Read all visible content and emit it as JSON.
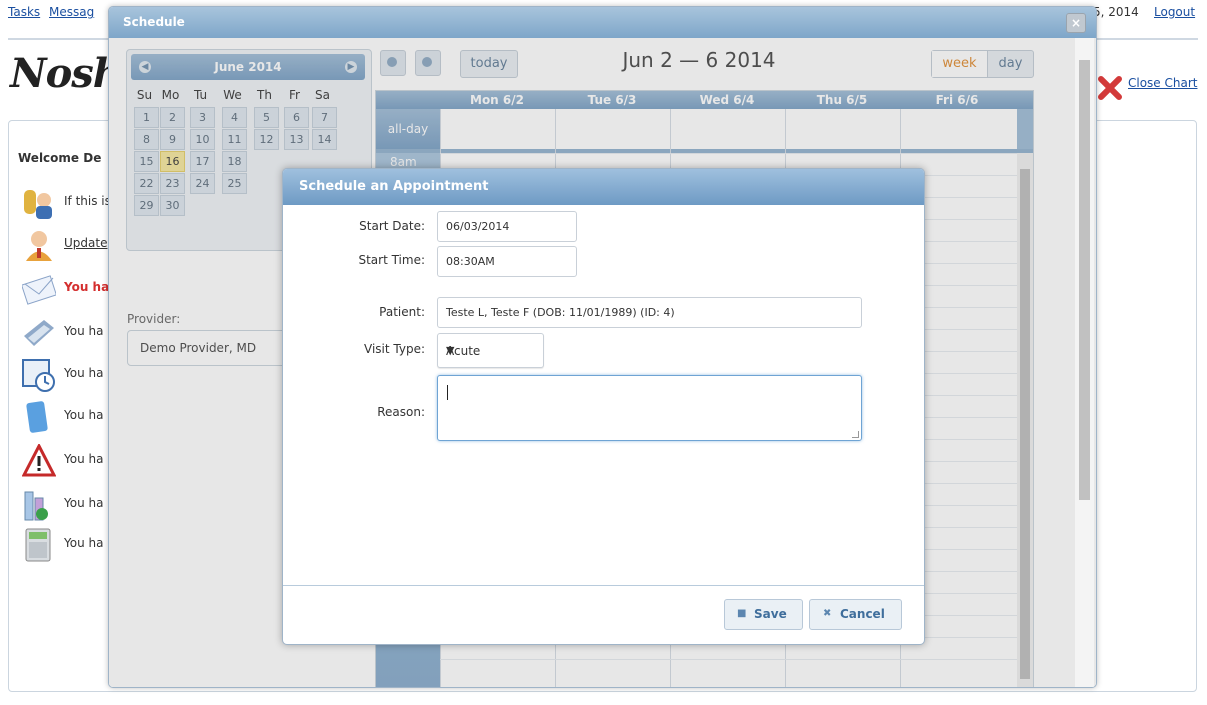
{
  "top_nav": {
    "tasks": "Tasks",
    "messages_partial": "Messag",
    "date_partial": "5, 2014",
    "logout": "Logout"
  },
  "brand": {
    "logo_text": "Nosh"
  },
  "sidebar": {
    "welcome_partial": "Welcome De",
    "alerts": [
      {
        "text": "If this is",
        "icon": "keys-person-icon",
        "highlight": false
      },
      {
        "text": "Update",
        "icon": "person-icon",
        "highlight": false,
        "link": true
      },
      {
        "text": "You ha",
        "icon": "envelope-icon",
        "highlight": true
      },
      {
        "text": "You ha",
        "icon": "scanner-icon",
        "highlight": false
      },
      {
        "text": "You ha",
        "icon": "calendar-clock-icon",
        "highlight": false
      },
      {
        "text": "You ha",
        "icon": "notebook-icon",
        "highlight": false
      },
      {
        "text": "You ha",
        "icon": "warning-icon",
        "highlight": false
      },
      {
        "text": "You ha",
        "icon": "lab-flask-icon",
        "highlight": false
      },
      {
        "text": "You ha",
        "icon": "calculator-icon",
        "highlight": false
      }
    ]
  },
  "close_chart": {
    "label": "Close Chart"
  },
  "schedule": {
    "title": "Schedule",
    "mini_calendar": {
      "month": "June 2014",
      "weekdays": [
        "Su",
        "Mo",
        "Tu",
        "We",
        "Th",
        "Fr",
        "Sa"
      ],
      "weeks": [
        [
          "1",
          "2",
          "3",
          "4",
          "5",
          "6",
          "7"
        ],
        [
          "8",
          "9",
          "10",
          "11",
          "12",
          "13",
          "14"
        ],
        [
          "15",
          "16",
          "17",
          "18",
          "",
          "",
          ""
        ],
        [
          "22",
          "23",
          "24",
          "25",
          "",
          "",
          ""
        ],
        [
          "29",
          "30",
          "",
          "",
          "",
          "",
          ""
        ]
      ],
      "today": "16"
    },
    "provider_label": "Provider:",
    "provider_value": "Demo Provider, MD",
    "toolbar": {
      "today": "today",
      "range": "Jun 2 — 6 2014",
      "week": "week",
      "day": "day"
    },
    "week_grid": {
      "columns": [
        "Mon 6/2",
        "Tue 6/3",
        "Wed 6/4",
        "Thu 6/5",
        "Fri 6/6"
      ],
      "allday_label": "all-day",
      "first_time": "8am"
    }
  },
  "appointment": {
    "title": "Schedule an Appointment",
    "start_date_label": "Start Date:",
    "start_date": "06/03/2014",
    "start_time_label": "Start Time:",
    "start_time": "08:30AM",
    "patient_label": "Patient:",
    "patient": "Teste L, Teste F (DOB: 11/01/1989) (ID: 4)",
    "visit_type_label": "Visit Type:",
    "visit_type": "Acute",
    "reason_label": "Reason:",
    "reason": "",
    "save": "Save",
    "cancel": "Cancel"
  }
}
